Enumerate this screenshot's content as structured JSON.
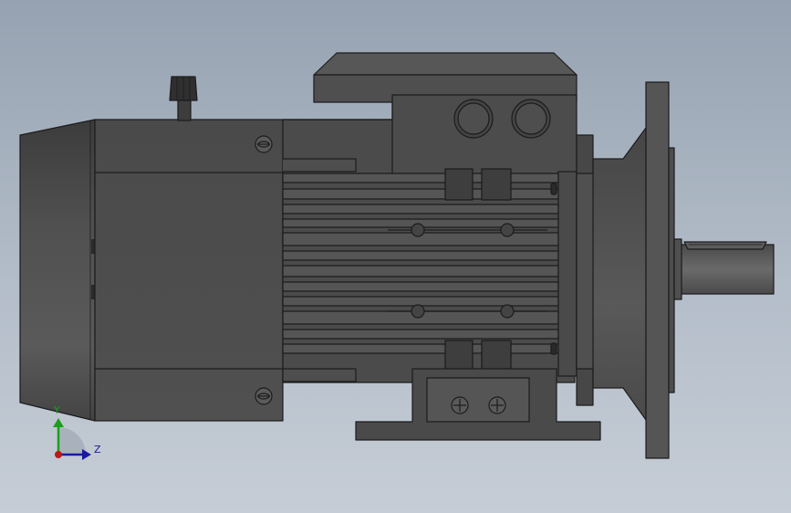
{
  "viewport": {
    "background_top": "#96a2b1",
    "background_bottom": "#c6cdd6"
  },
  "model": {
    "body_color": "#4e4e4e",
    "edge_color": "#1c1c1c",
    "highlight_color": "#6a6a6a"
  },
  "triad": {
    "y_label": "Y",
    "z_label": "Z",
    "y_color": "#1aa01a",
    "z_color": "#1a1aa0",
    "origin_color": "#c01818"
  }
}
